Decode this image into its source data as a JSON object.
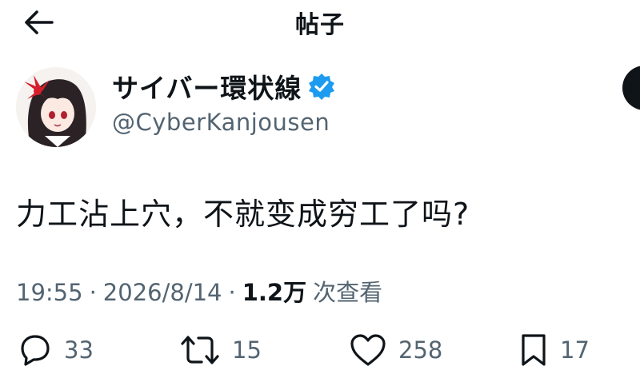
{
  "header": {
    "title": "帖子",
    "back_icon": "arrow-left-icon"
  },
  "author": {
    "display_name": "サイバー環状線",
    "handle": "@CyberKanjousen",
    "verified_icon": "verified-badge-icon",
    "verified_color": "#1d9bf0"
  },
  "tweet": {
    "text": "力工沾上穴，不就变成穷工了吗?",
    "time": "19:55",
    "date": "2026/8/14",
    "views_count": "1.2万",
    "views_label": "次查看",
    "separator": "·"
  },
  "actions": {
    "reply": {
      "icon": "reply-icon",
      "count": "33"
    },
    "retweet": {
      "icon": "retweet-icon",
      "count": "15"
    },
    "like": {
      "icon": "heart-icon",
      "count": "258"
    },
    "bookmark": {
      "icon": "bookmark-icon",
      "count": "17"
    }
  },
  "colors": {
    "text_primary": "#0f1419",
    "text_secondary": "#536471",
    "accent": "#1d9bf0",
    "background": "#ffffff"
  }
}
